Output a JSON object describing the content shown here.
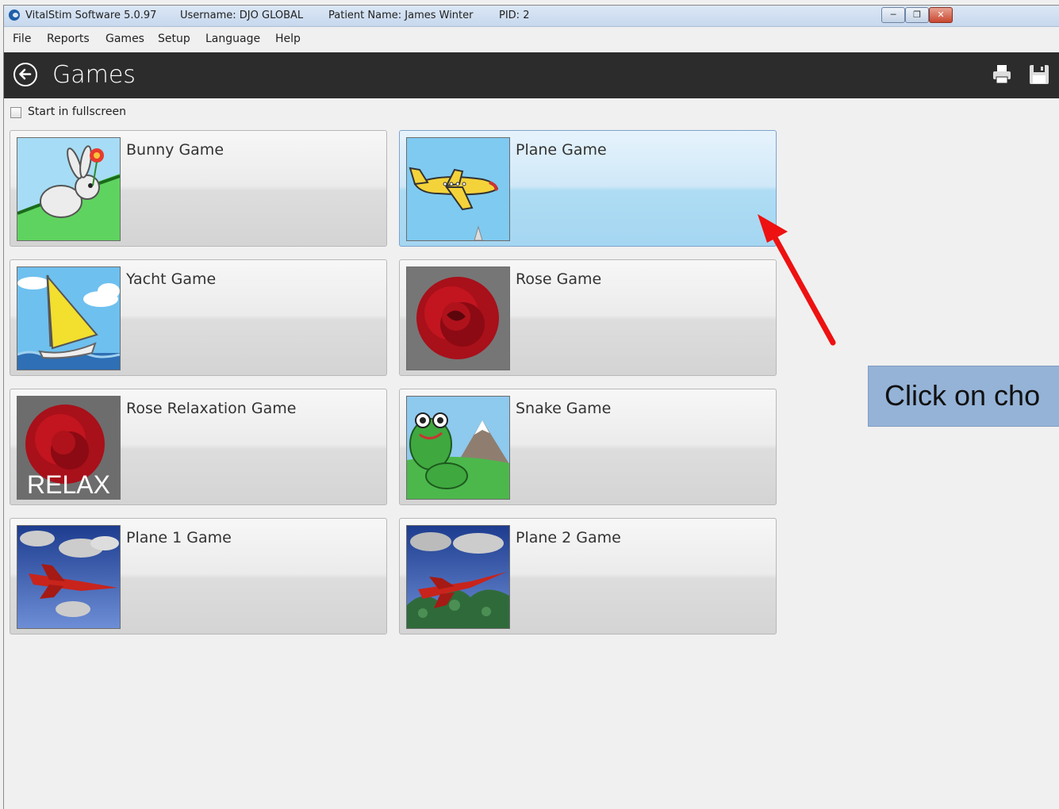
{
  "window": {
    "title_app": "VitalStim Software 5.0.97",
    "title_user": "Username: DJO GLOBAL",
    "title_patient": "Patient Name: James Winter",
    "title_pid": "PID: 2"
  },
  "menu": [
    "File",
    "Reports",
    "Games",
    "Setup",
    "Language",
    "Help"
  ],
  "header": {
    "title": "Games"
  },
  "options": {
    "fullscreen_label": "Start in fullscreen",
    "fullscreen_checked": false
  },
  "games": [
    {
      "label": "Bunny Game",
      "icon": "bunny-thumbnail"
    },
    {
      "label": "Plane Game",
      "icon": "plane-thumbnail",
      "selected": true
    },
    {
      "label": "Yacht Game",
      "icon": "yacht-thumbnail"
    },
    {
      "label": "Rose Game",
      "icon": "rose-thumbnail"
    },
    {
      "label": "Rose Relaxation Game",
      "icon": "rose-relax-thumbnail",
      "thumb_text": "RELAX"
    },
    {
      "label": "Snake Game",
      "icon": "snake-thumbnail"
    },
    {
      "label": "Plane 1 Game",
      "icon": "jet-thumbnail"
    },
    {
      "label": "Plane 2 Game",
      "icon": "jet-forest-thumbnail"
    }
  ],
  "annotation": {
    "text": "Click on cho",
    "arrow_color": "#ee1111"
  },
  "colors": {
    "header": "#2c2c2c",
    "selected_tile": "#bfe3f6",
    "callout": "#95b3d7"
  }
}
